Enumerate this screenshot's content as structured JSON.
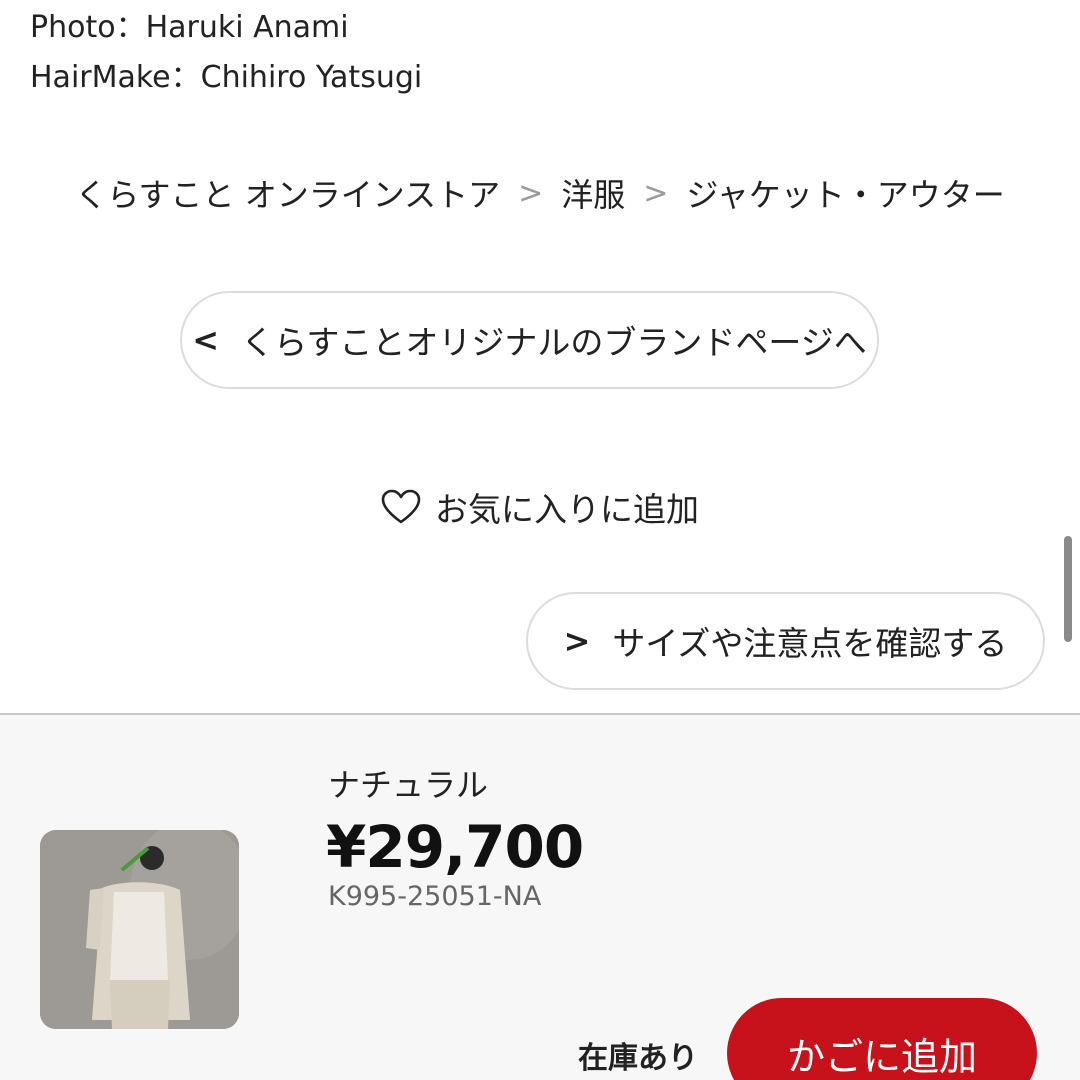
{
  "credits": {
    "photo": "Photo：Haruki Anami",
    "hairmake": "HairMake：Chihiro Yatsugi"
  },
  "breadcrumb": {
    "items": [
      "くらすこと オンラインストア",
      "洋服",
      "ジャケット・アウター"
    ],
    "separator": ">"
  },
  "brand_link": {
    "chevron": "<",
    "label": "くらすことオリジナルのブランドページへ"
  },
  "favorite": {
    "label": "お気に入りに追加",
    "icon": "heart-icon"
  },
  "size_link": {
    "chevron": ">",
    "label": "サイズや注意点を確認する"
  },
  "product": {
    "variant": "ナチュラル",
    "price": "¥29,700",
    "sku": "K995-25051-NA",
    "stock": "在庫あり",
    "cart_label": "かごに追加"
  },
  "colors": {
    "accent": "#c8121b",
    "bar_bg": "#f7f7f7"
  }
}
